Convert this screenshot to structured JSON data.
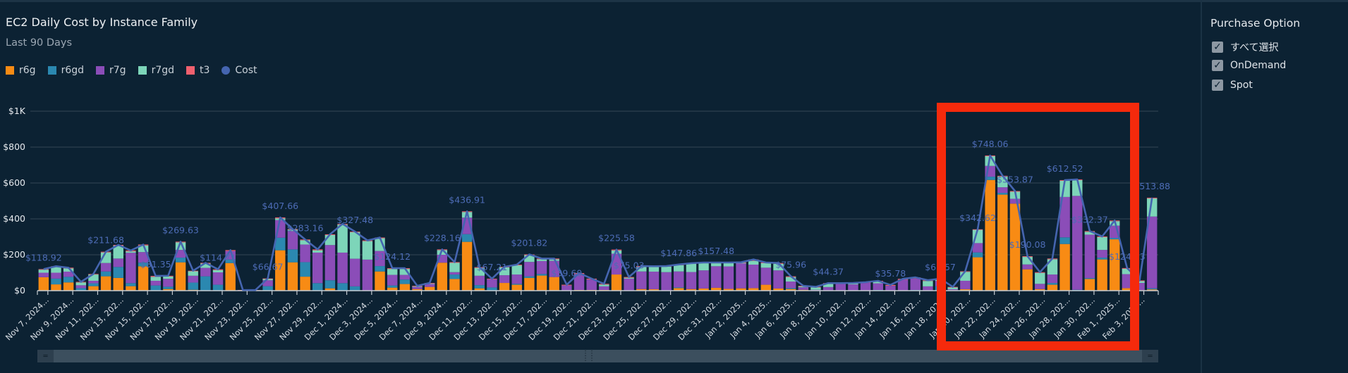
{
  "header": {
    "title": "EC2 Daily Cost by Instance Family",
    "subtitle": "Last 90 Days"
  },
  "legend": [
    {
      "label": "r6g",
      "color": "#f88b14",
      "shape": "square"
    },
    {
      "label": "r6gd",
      "color": "#2b88b0",
      "shape": "square"
    },
    {
      "label": "r7g",
      "color": "#8b4db8",
      "shape": "square"
    },
    {
      "label": "r7gd",
      "color": "#7dd5b9",
      "shape": "square"
    },
    {
      "label": "t3",
      "color": "#f0606e",
      "shape": "square"
    },
    {
      "label": "Cost",
      "color": "#4565b0",
      "shape": "circle"
    }
  ],
  "filter_panel": {
    "title": "Purchase Option",
    "options": [
      {
        "label": "すべて選択",
        "checked": true
      },
      {
        "label": "OnDemand",
        "checked": true
      },
      {
        "label": "Spot",
        "checked": true
      }
    ]
  },
  "chart_data": {
    "type": "bar",
    "stacked": true,
    "title": "EC2 Daily Cost by Instance Family",
    "subtitle": "Last 90 Days",
    "series_names": [
      "r6g",
      "r6gd",
      "r7g",
      "r7gd",
      "t3"
    ],
    "line_series": "Cost",
    "ylim": [
      0,
      1000
    ],
    "y_ticks": [
      "$0",
      "$200",
      "$400",
      "$600",
      "$800",
      "$1K"
    ],
    "grid": true,
    "legend_position": "top-left",
    "x_tick_labels": [
      "Nov 7, 2024...",
      "Nov 9, 2024...",
      "Nov 11, 202...",
      "Nov 13, 202...",
      "Nov 15, 202...",
      "Nov 17, 202...",
      "Nov 19, 202...",
      "Nov 21, 202...",
      "Nov 23, 202...",
      "Nov 25, 202...",
      "Nov 27, 202...",
      "Nov 29, 202...",
      "Dec 1, 2024...",
      "Dec 3, 2024...",
      "Dec 5, 2024...",
      "Dec 7, 2024...",
      "Dec 9, 2024...",
      "Dec 11, 202...",
      "Dec 13, 202...",
      "Dec 15, 202...",
      "Dec 17, 202...",
      "Dec 19, 202...",
      "Dec 21, 202...",
      "Dec 23, 202...",
      "Dec 25, 202...",
      "Dec 27, 202...",
      "Dec 29, 202...",
      "Dec 31, 202...",
      "Jan 2, 2025...",
      "Jan 4, 2025...",
      "Jan 6, 2025...",
      "Jan 8, 2025...",
      "Jan 10, 202...",
      "Jan 12, 202...",
      "Jan 14, 202...",
      "Jan 16, 202...",
      "Jan 18, 202...",
      "Jan 20, 202...",
      "Jan 22, 202...",
      "Jan 24, 202...",
      "Jan 26, 202...",
      "Jan 28, 202...",
      "Jan 30, 202...",
      "Feb 1, 2025...",
      "Feb 3, 2025..."
    ],
    "days": [
      [
        75,
        0,
        25,
        17,
        3
      ],
      [
        35,
        32,
        33,
        33,
        3
      ],
      [
        46,
        31,
        29,
        18,
        4
      ],
      [
        0,
        14,
        16,
        16,
        3
      ],
      [
        25,
        16,
        14,
        35,
        3
      ],
      [
        80,
        27,
        47,
        59,
        4
      ],
      [
        71,
        61,
        47,
        72,
        4
      ],
      [
        25,
        17,
        169,
        8,
        5
      ],
      [
        136,
        20,
        59,
        37,
        5
      ],
      [
        0,
        29,
        26,
        22,
        5
      ],
      [
        9,
        13,
        44,
        13,
        4
      ],
      [
        158,
        26,
        43,
        42,
        4
      ],
      [
        5,
        40,
        38,
        25,
        3
      ],
      [
        0,
        80,
        47,
        24,
        4
      ],
      [
        0,
        33,
        69,
        13,
        4
      ],
      [
        154,
        20,
        47,
        0,
        5
      ],
      [
        0,
        0,
        0,
        0,
        4
      ],
      [
        0,
        0,
        0,
        0,
        3
      ],
      [
        0,
        25,
        33,
        8,
        2
      ],
      [
        225,
        70,
        98,
        10,
        5
      ],
      [
        158,
        72,
        102,
        9,
        2
      ],
      [
        78,
        81,
        98,
        24,
        4
      ],
      [
        0,
        42,
        170,
        13,
        5
      ],
      [
        13,
        45,
        196,
        56,
        4
      ],
      [
        0,
        42,
        170,
        156,
        4
      ],
      [
        0,
        24,
        154,
        148,
        3
      ],
      [
        0,
        0,
        173,
        103,
        4
      ],
      [
        107,
        30,
        84,
        71,
        4
      ],
      [
        17,
        12,
        59,
        33,
        4
      ],
      [
        37,
        25,
        26,
        33,
        4
      ],
      [
        9,
        0,
        12,
        4,
        2
      ],
      [
        21,
        0,
        16,
        3,
        3
      ],
      [
        156,
        0,
        44,
        26,
        4
      ],
      [
        65,
        25,
        13,
        52,
        4
      ],
      [
        272,
        43,
        92,
        31,
        4
      ],
      [
        13,
        18,
        52,
        44,
        4
      ],
      [
        0,
        18,
        46,
        0,
        3
      ],
      [
        43,
        0,
        43,
        44,
        3
      ],
      [
        33,
        5,
        52,
        51,
        4
      ],
      [
        71,
        9,
        80,
        38,
        4
      ],
      [
        84,
        9,
        72,
        10,
        4
      ],
      [
        76,
        0,
        90,
        9,
        4
      ],
      [
        0,
        0,
        29,
        0,
        4
      ],
      [
        4,
        0,
        89,
        0,
        5
      ],
      [
        4,
        0,
        58,
        0,
        5
      ],
      [
        4,
        0,
        20,
        10,
        4
      ],
      [
        90,
        0,
        116,
        18,
        5
      ],
      [
        0,
        0,
        67,
        5,
        4
      ],
      [
        9,
        0,
        98,
        25,
        5
      ],
      [
        8,
        0,
        98,
        26,
        4
      ],
      [
        0,
        0,
        103,
        31,
        3
      ],
      [
        14,
        4,
        89,
        35,
        4
      ],
      [
        9,
        0,
        95,
        45,
        4
      ],
      [
        12,
        0,
        101,
        41,
        3
      ],
      [
        16,
        0,
        120,
        17,
        4
      ],
      [
        10,
        0,
        125,
        18,
        4
      ],
      [
        13,
        0,
        140,
        2,
        3
      ],
      [
        14,
        0,
        131,
        21,
        8
      ],
      [
        33,
        0,
        95,
        25,
        4
      ],
      [
        12,
        0,
        101,
        37,
        4
      ],
      [
        9,
        5,
        37,
        25,
        4
      ],
      [
        5,
        0,
        14,
        5,
        3
      ],
      [
        0,
        0,
        5,
        13,
        3
      ],
      [
        0,
        0,
        20,
        18,
        4
      ],
      [
        0,
        0,
        38,
        0,
        4
      ],
      [
        0,
        0,
        35,
        5,
        3
      ],
      [
        0,
        0,
        43,
        0,
        4
      ],
      [
        0,
        4,
        37,
        10,
        4
      ],
      [
        0,
        0,
        27,
        0,
        5
      ],
      [
        0,
        0,
        61,
        0,
        5
      ],
      [
        0,
        4,
        63,
        0,
        7
      ],
      [
        0,
        0,
        24,
        30,
        4
      ],
      [
        0,
        24,
        30,
        10,
        3
      ],
      [
        3,
        0,
        5,
        10,
        3
      ],
      [
        8,
        0,
        47,
        50,
        3
      ],
      [
        186,
        27,
        52,
        74,
        3
      ],
      [
        617,
        18,
        60,
        54,
        4
      ],
      [
        535,
        10,
        31,
        60,
        4
      ],
      [
        485,
        0,
        27,
        39,
        4
      ],
      [
        119,
        0,
        27,
        42,
        4
      ],
      [
        9,
        0,
        29,
        61,
        4
      ],
      [
        33,
        10,
        47,
        85,
        4
      ],
      [
        260,
        37,
        225,
        90,
        4
      ],
      [
        0,
        5,
        523,
        88,
        4
      ],
      [
        65,
        5,
        242,
        16,
        4
      ],
      [
        174,
        10,
        43,
        71,
        4
      ],
      [
        286,
        8,
        68,
        25,
        4
      ],
      [
        14,
        0,
        78,
        30,
        4
      ],
      [
        3,
        0,
        40,
        10,
        4
      ],
      [
        7,
        6,
        400,
        101,
        4
      ]
    ],
    "cost_labels": [
      {
        "index": 0,
        "text": "$118.92"
      },
      {
        "index": 5,
        "text": "$211.68"
      },
      {
        "index": 9,
        "text": "$81.35"
      },
      {
        "index": 11,
        "text": "$269.63"
      },
      {
        "index": 14,
        "text": "$114.71"
      },
      {
        "index": 18,
        "text": "$66.67"
      },
      {
        "index": 19,
        "text": "$407.66"
      },
      {
        "index": 21,
        "text": "$283.16"
      },
      {
        "index": 25,
        "text": "$327.48"
      },
      {
        "index": 28,
        "text": "$124.12"
      },
      {
        "index": 32,
        "text": "$228.16"
      },
      {
        "index": 34,
        "text": "$436.91"
      },
      {
        "index": 36,
        "text": "$67.21"
      },
      {
        "index": 39,
        "text": "$201.82"
      },
      {
        "index": 42,
        "text": "$39.60"
      },
      {
        "index": 46,
        "text": "$225.58"
      },
      {
        "index": 47,
        "text": "$75.03"
      },
      {
        "index": 51,
        "text": "$147.86"
      },
      {
        "index": 54,
        "text": "$157.48"
      },
      {
        "index": 60,
        "text": "$75.96"
      },
      {
        "index": 63,
        "text": "$44.37"
      },
      {
        "index": 68,
        "text": "$35.78"
      },
      {
        "index": 72,
        "text": "$63.57"
      },
      {
        "index": 75,
        "text": "$342.62"
      },
      {
        "index": 76,
        "text": "$748.06"
      },
      {
        "index": 78,
        "text": "$553.87"
      },
      {
        "index": 79,
        "text": "$190.08"
      },
      {
        "index": 82,
        "text": "$612.52"
      },
      {
        "index": 84,
        "text": "$332.37"
      },
      {
        "index": 87,
        "text": "$124.13"
      },
      {
        "index": 89,
        "text": "$513.88"
      }
    ]
  },
  "annotation": {
    "highlight_color": "#f52a0c"
  }
}
